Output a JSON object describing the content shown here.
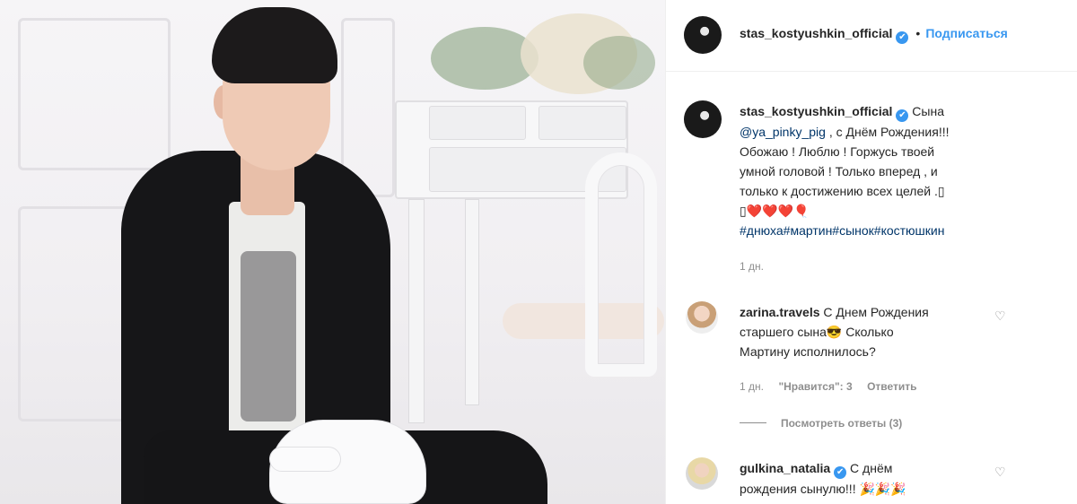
{
  "header": {
    "username": "stas_kostyushkin_official",
    "follow_label": "Подписаться"
  },
  "caption": {
    "username": "stas_kostyushkin_official",
    "line1_text": "Сына",
    "mention": "@ya_pinky_pig",
    "line2_text": ", с Днём Рождения!!!",
    "line3": "Обожаю ! Люблю ! Горжусь твоей",
    "line4": "умной головой ! Только вперед , и",
    "line5": "только к достижению всех целей .▯",
    "line6": "▯❤️❤️❤️🎈",
    "hashtags": "#днюха#мартин#сынок#костюшкин",
    "time": "1 дн."
  },
  "comments": [
    {
      "username": "zarina.travels",
      "line1": "С Днем Рождения",
      "line2": "старшего сына😎 Сколько",
      "line3": "Мартину исполнилось?",
      "time": "1 дн.",
      "likes": "\"Нравится\": 3",
      "reply_label": "Ответить",
      "view_replies": "Посмотреть ответы (3)"
    },
    {
      "username": "gulkina_natalia",
      "line1": "С днём",
      "line2": "рождения сынулю!!! 🎉🎉🎉"
    }
  ],
  "icons": {
    "verified": "✔",
    "heart": "♡"
  }
}
